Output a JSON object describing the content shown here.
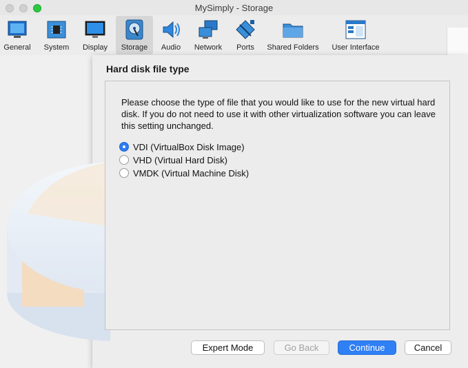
{
  "window": {
    "title": "MySimply - Storage"
  },
  "toolbar": {
    "items": [
      {
        "label": "General",
        "icon": "general-icon"
      },
      {
        "label": "System",
        "icon": "chip-icon"
      },
      {
        "label": "Display",
        "icon": "monitor-icon"
      },
      {
        "label": "Storage",
        "icon": "disk-icon",
        "active": true
      },
      {
        "label": "Audio",
        "icon": "speaker-icon"
      },
      {
        "label": "Network",
        "icon": "network-icon"
      },
      {
        "label": "Ports",
        "icon": "plug-icon"
      },
      {
        "label": "Shared Folders",
        "icon": "folder-icon"
      },
      {
        "label": "User Interface",
        "icon": "window-icon"
      }
    ]
  },
  "wizard": {
    "heading": "Hard disk file type",
    "description": "Please choose the type of file that you would like to use for the new virtual hard disk. If you do not need to use it with other virtualization software you can leave this setting unchanged.",
    "options": [
      {
        "label": "VDI (VirtualBox Disk Image)",
        "checked": true
      },
      {
        "label": "VHD (Virtual Hard Disk)",
        "checked": false
      },
      {
        "label": "VMDK (Virtual Machine Disk)",
        "checked": false
      }
    ],
    "buttons": {
      "expert": "Expert Mode",
      "back": "Go Back",
      "continue": "Continue",
      "cancel": "Cancel"
    }
  },
  "colors": {
    "accent": "#2f7ff5",
    "close_green": "#2cc840"
  }
}
